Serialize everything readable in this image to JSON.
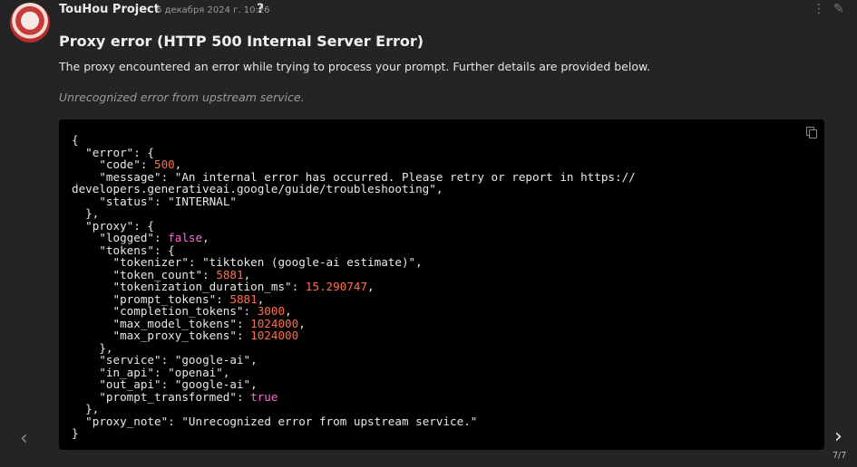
{
  "post": {
    "author": "TouHou Project",
    "date": "6 декабря 2024 г. 10:26",
    "help_icon": "?",
    "title": "Proxy error (HTTP 500 Internal Server Error)",
    "description": "The proxy encountered an error while trying to process your prompt. Further details are provided below.",
    "note": "Unrecognized error from upstream service."
  },
  "code": {
    "error_code": "500",
    "message_1": "\"An internal error has occurred. Please retry or report in https://",
    "message_2": "developers.generativeai.google/guide/troubleshooting\",",
    "status": "\"INTERNAL\"",
    "logged": "false",
    "tokenizer": "\"tiktoken (google-ai estimate)\",",
    "token_count": "5881",
    "tokenization_duration_ms": "15.290747",
    "prompt_tokens": "5881",
    "completion_tokens": "3000",
    "max_model_tokens": "1024000",
    "max_proxy_tokens": "1024000",
    "service": "\"google-ai\",",
    "in_api": "\"openai\",",
    "out_api": "\"google-ai\",",
    "prompt_transformed": "true",
    "proxy_note": "\"Unrecognized error from upstream service.\""
  },
  "navigation": {
    "prev_icon": "‹",
    "next_icon": "›",
    "pager": "7/7"
  },
  "colors": {
    "background": "#242424",
    "code_background": "#000000",
    "number": "#ff6e49",
    "boolean": "#ff6ad5"
  }
}
